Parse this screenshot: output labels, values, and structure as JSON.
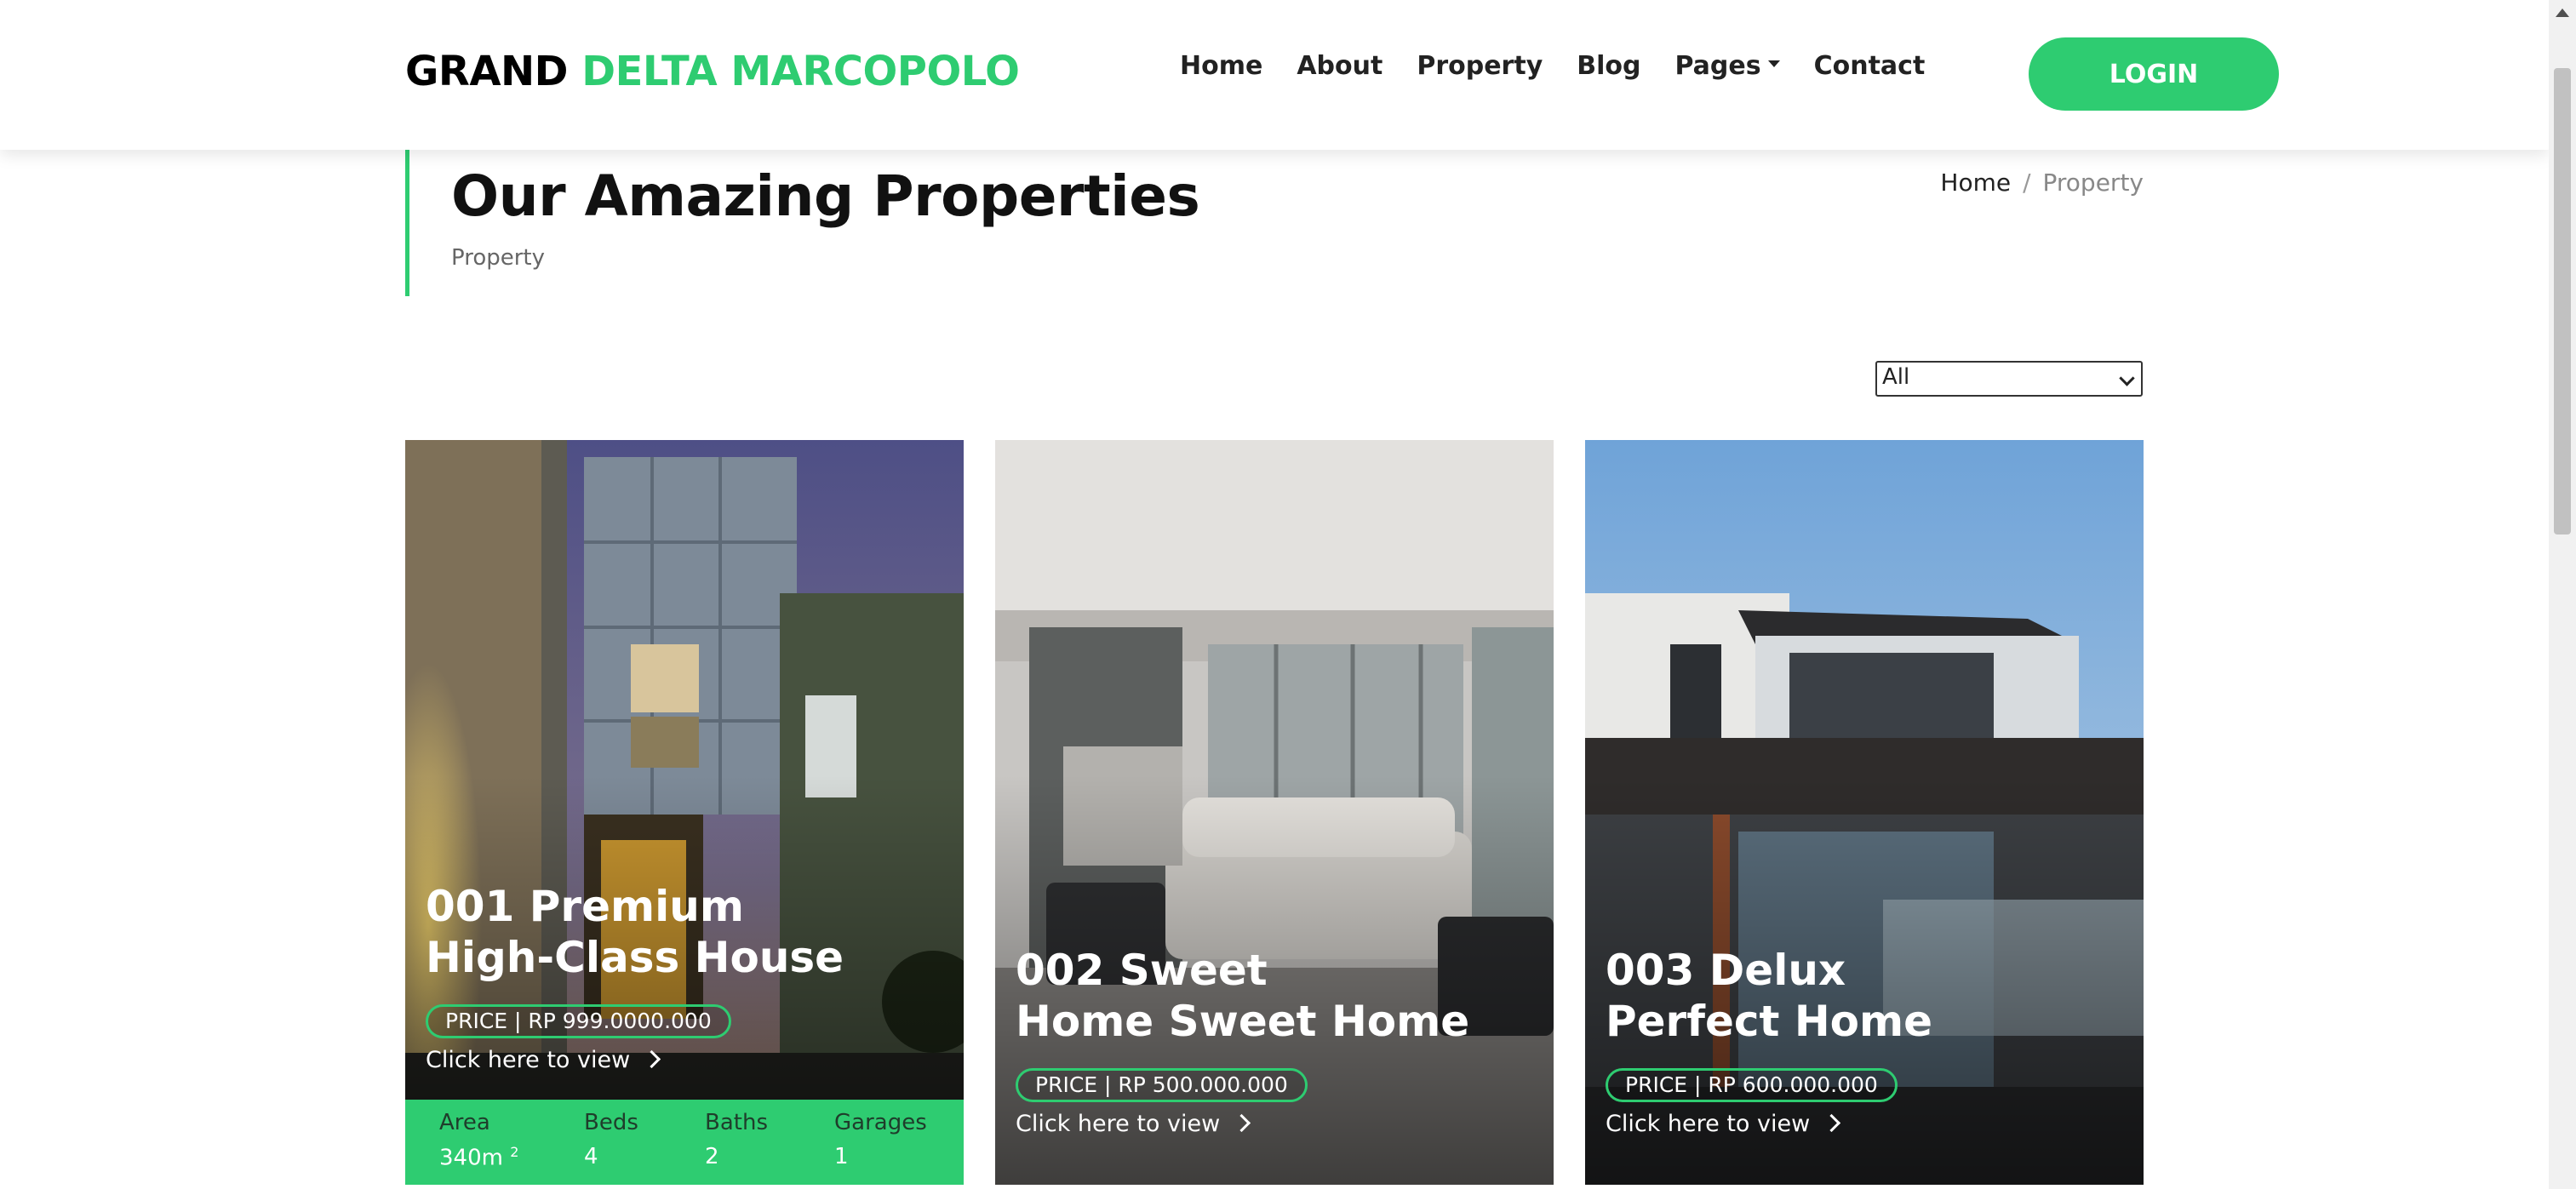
{
  "brand": {
    "part1": "GRAND",
    "part2": "DELTA MARCOPOLO"
  },
  "nav": [
    "Home",
    "About",
    "Property",
    "Blog",
    "Pages",
    "Contact"
  ],
  "login_label": "LOGIN",
  "heading": {
    "title": "Our Amazing Properties",
    "subtitle": "Property"
  },
  "breadcrumb": {
    "home": "Home",
    "sep": "/",
    "current": "Property"
  },
  "filter": {
    "selected": "All"
  },
  "cards": [
    {
      "title_line1": "001 Premium",
      "title_line2": "High-Class House",
      "price": "PRICE | RP 999.0000.000",
      "cta": "Click here to view",
      "stats": {
        "area_label": "Area",
        "area_value": "340m",
        "area_unit": "2",
        "beds_label": "Beds",
        "beds_value": "4",
        "baths_label": "Baths",
        "baths_value": "2",
        "garages_label": "Garages",
        "garages_value": "1"
      }
    },
    {
      "title_line1": "002 Sweet",
      "title_line2": "Home Sweet Home",
      "price": "PRICE | RP 500.000.000",
      "cta": "Click here to view"
    },
    {
      "title_line1": "003 Delux",
      "title_line2": "Perfect Home",
      "price": "PRICE | RP 600.000.000",
      "cta": "Click here to view"
    }
  ],
  "colors": {
    "accent": "#2ecc71",
    "text": "#222222",
    "muted": "#888888"
  }
}
